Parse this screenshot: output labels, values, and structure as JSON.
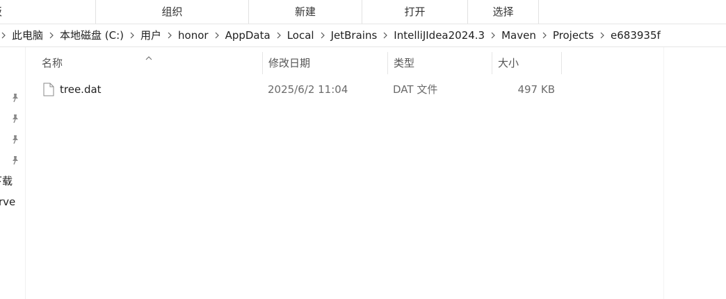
{
  "ribbon": {
    "groups": [
      "板",
      "组织",
      "新建",
      "打开",
      "选择"
    ]
  },
  "address": {
    "crumbs": [
      "此电脑",
      "本地磁盘 (C:)",
      "用户",
      "honor",
      "AppData",
      "Local",
      "JetBrains",
      "IntelliJIdea2024.3",
      "Maven",
      "Projects",
      "e683935f"
    ]
  },
  "nav": {
    "items": [
      "下载",
      "rve"
    ]
  },
  "columns": {
    "name": "名称",
    "date": "修改日期",
    "type": "类型",
    "size": "大小"
  },
  "files": [
    {
      "name": "tree.dat",
      "date": "2025/6/2 11:04",
      "type": "DAT 文件",
      "size": "497 KB"
    }
  ]
}
